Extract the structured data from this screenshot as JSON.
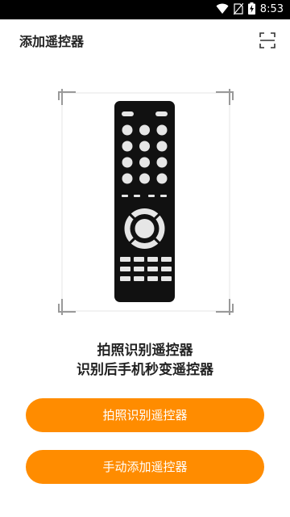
{
  "status_bar": {
    "time": "8:53",
    "icons": [
      "wifi-icon",
      "no-sim-icon",
      "battery-charging-icon"
    ]
  },
  "app_bar": {
    "title": "添加遥控器",
    "action_icon": "scan-icon"
  },
  "illustration": {
    "icon": "tv-remote-illustration"
  },
  "hint": {
    "line1": "拍照识别遥控器",
    "line2": "识别后手机秒变遥控器"
  },
  "buttons": {
    "photo_label": "拍照识别遥控器",
    "manual_label": "手动添加遥控器"
  },
  "colors": {
    "accent": "#ff8c00",
    "status_bar": "#000000",
    "remote_body": "#111111",
    "remote_buttons": "#e6e6e6"
  }
}
